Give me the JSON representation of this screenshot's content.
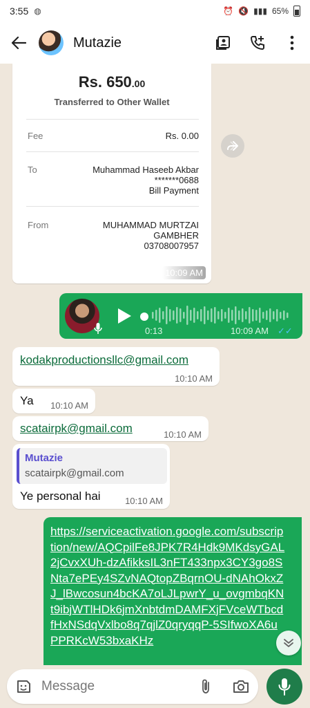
{
  "status_bar": {
    "time": "3:55",
    "battery": "65%"
  },
  "header": {
    "contact_name": "Mutazie"
  },
  "receipt": {
    "amount_main": "Rs. 650",
    "amount_decimal": ".00",
    "subtitle": "Transferred to Other Wallet",
    "fee_label": "Fee",
    "fee_value": "Rs. 0.00",
    "to_label": "To",
    "to_line1": "Muhammad Haseeb Akbar",
    "to_line2": "*******0688",
    "to_line3": "Bill Payment",
    "from_label": "From",
    "from_line1": "MUHAMMAD MURTZAI",
    "from_line2": "GAMBHER",
    "from_line3": "03708007957",
    "time": "10:09 AM"
  },
  "voice_message": {
    "duration": "0:13",
    "time": "10:09 AM",
    "read_ticks": "✓✓"
  },
  "messages": [
    {
      "text": "kodakproductionsllc@gmail.com",
      "time": "10:10 AM"
    },
    {
      "text": "Ya",
      "time": "10:10 AM"
    },
    {
      "text": "scatairpk@gmail.com",
      "time": "10:10 AM"
    },
    {
      "quote_name": "Mutazie",
      "quote_text": "scatairpk@gmail.com",
      "text": "Ye personal hai",
      "time": "10:10 AM"
    }
  ],
  "outgoing_link": {
    "url": "https://serviceactivation.google.com/subscription/new/AQCpilFe8JPK7R4Hdk9MKdsyGAL2jCvxXUh-dzAfikksIL3nFT433npx3CY3go8SNta7ePEy4SZvNAQtopZBqrnOU-dNAhOkxZJ_lBwcosun4bcKA7oLJLpwrY_u_ovgmbqKNt9ibjWTlHDk6jmXnbtdmDAMFXjFVceWTbcdfHxNSdqVxlbo8q7qjlZ0qryqqP-5SIfwoXA6uPPRKcW53bxaKHz"
  },
  "composer": {
    "placeholder": "Message"
  },
  "colors": {
    "outgoing_bubble": "#1aa757",
    "incoming_bubble": "#ffffff",
    "chat_background": "#efe7dc",
    "mic_button": "#1f7d4a",
    "quote_accent": "#5a4fcf"
  },
  "icons": [
    "back-arrow-icon",
    "contact-card-icon",
    "add-call-icon",
    "more-vert-icon",
    "forward-icon",
    "play-icon",
    "mic-icon",
    "chevron-down-icon",
    "emoji-icon",
    "attach-icon",
    "camera-icon"
  ]
}
